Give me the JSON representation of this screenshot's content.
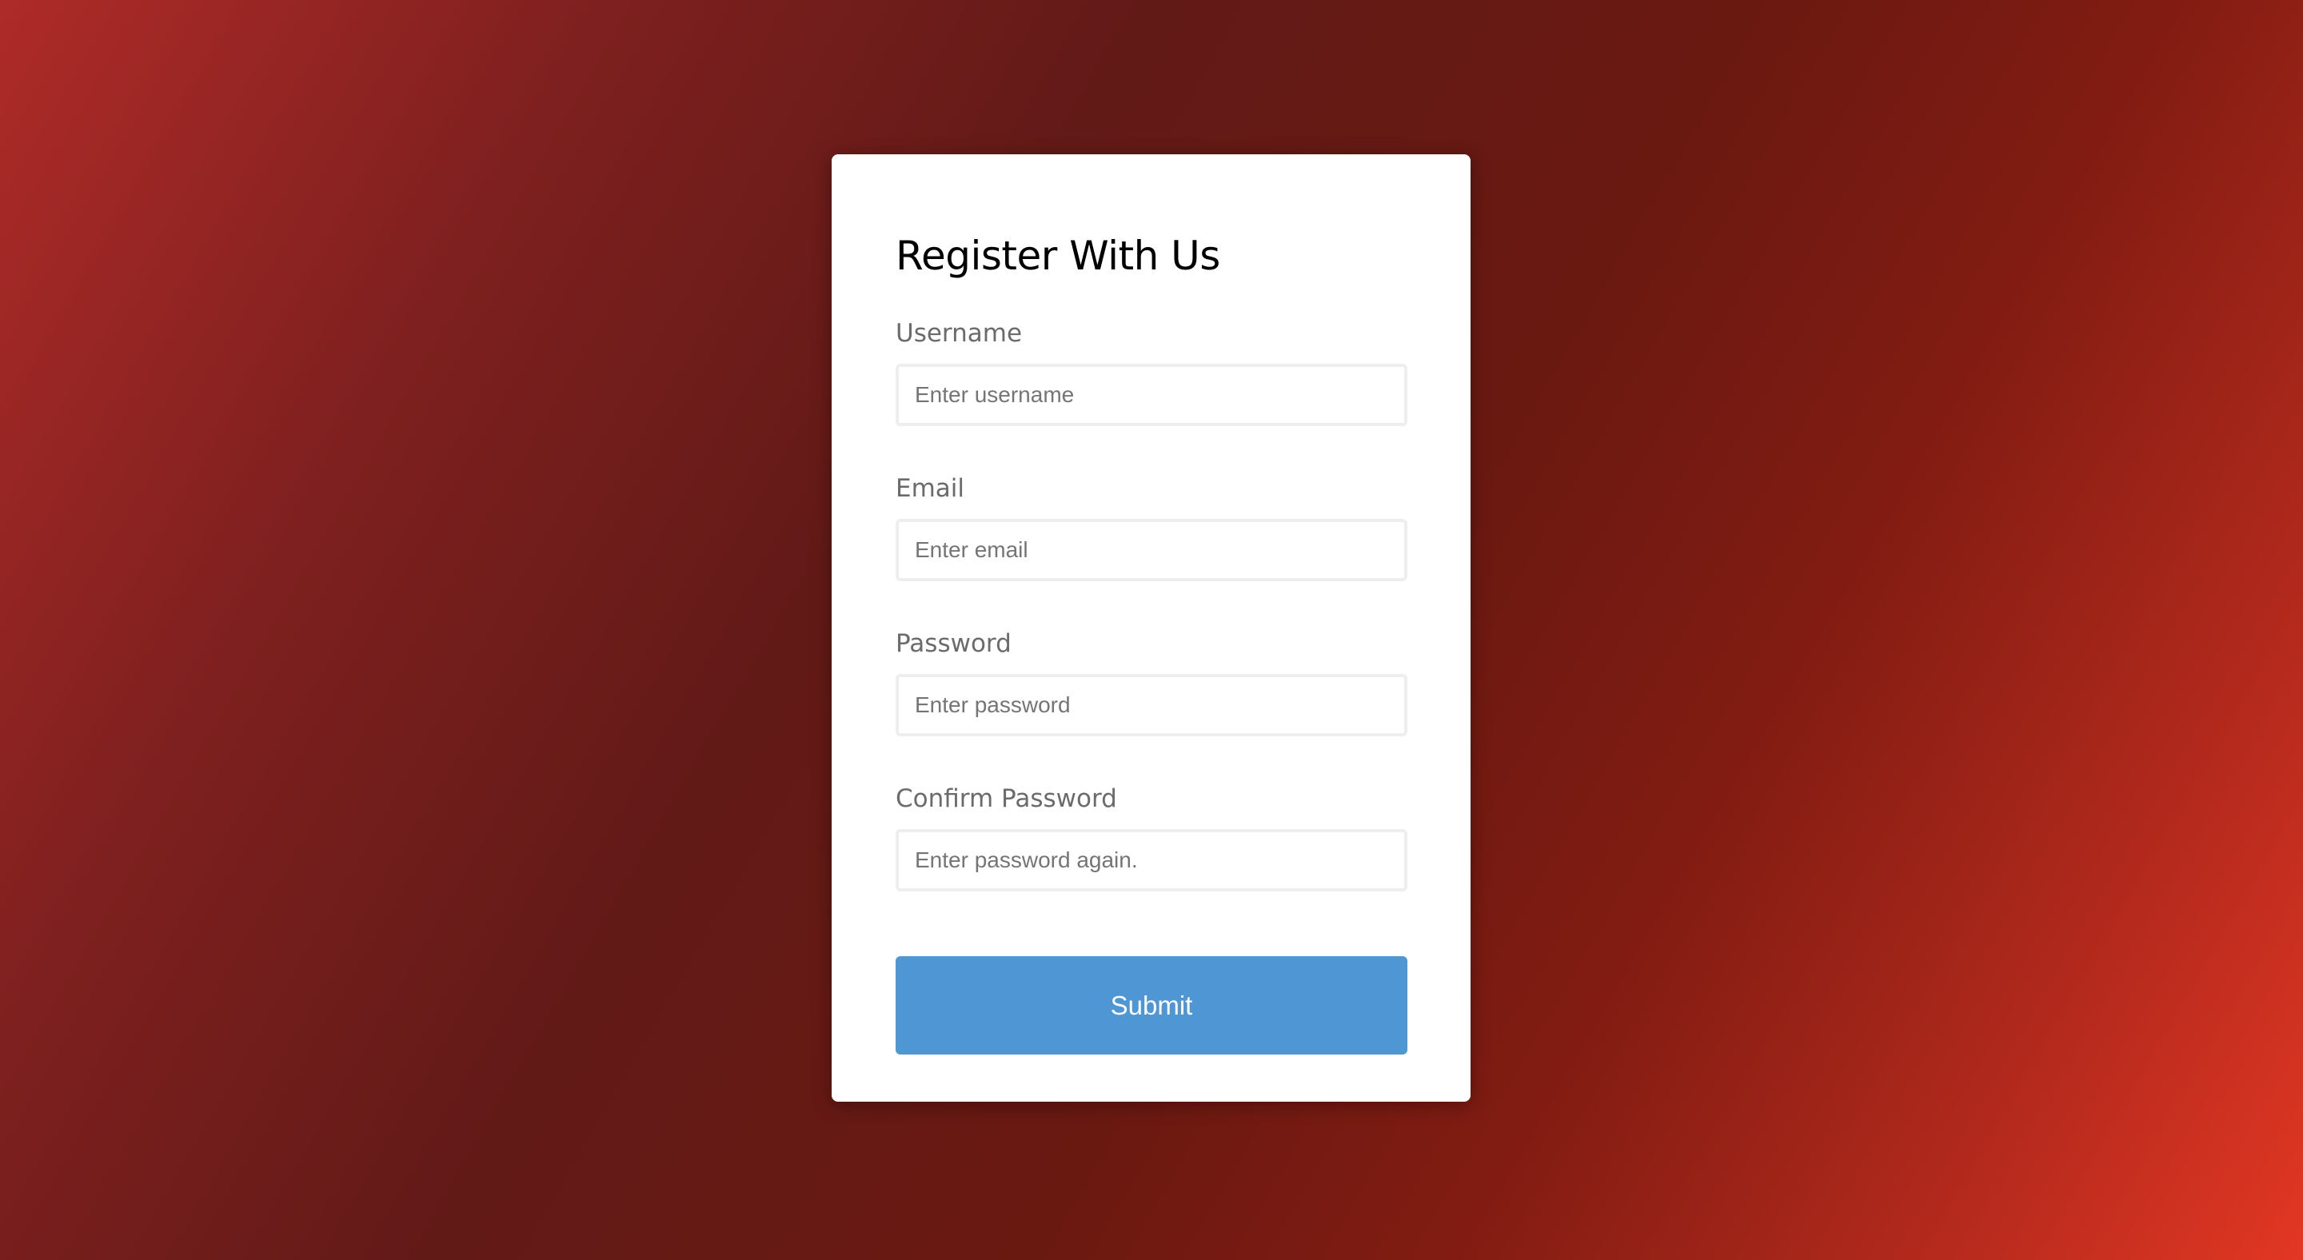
{
  "form": {
    "title": "Register With Us",
    "fields": [
      {
        "label": "Username",
        "placeholder": "Enter username",
        "value": ""
      },
      {
        "label": "Email",
        "placeholder": "Enter email",
        "value": ""
      },
      {
        "label": "Password",
        "placeholder": "Enter password",
        "value": ""
      },
      {
        "label": "Confirm Password",
        "placeholder": "Enter password again.",
        "value": ""
      }
    ],
    "submit_label": "Submit"
  },
  "colors": {
    "button": "#4f97d4",
    "background_dark": "#621a17",
    "background_light": "#e23723"
  }
}
